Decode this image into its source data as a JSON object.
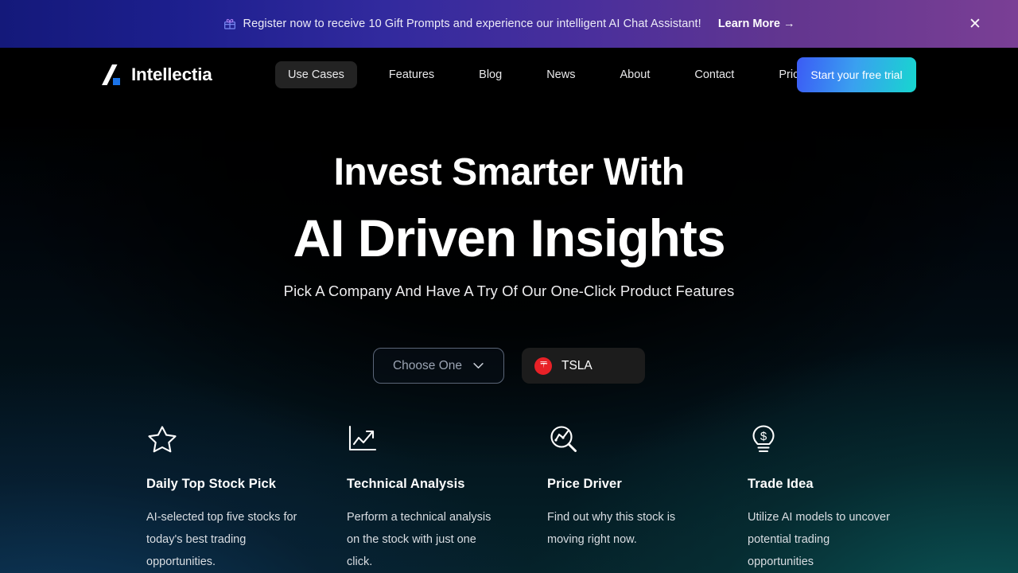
{
  "banner": {
    "icon": "gift-icon",
    "message": "Register now to receive 10 Gift Prompts and experience our intelligent AI Chat Assistant!",
    "learn_more": "Learn More →",
    "close": "✕",
    "gradient_from": "#14197a",
    "gradient_to": "#7a3f95"
  },
  "nav": {
    "logo_text": "Intellectia",
    "logo_accent": "#1a73e8",
    "items": [
      {
        "label": "Use Cases",
        "active": true
      },
      {
        "label": "Features",
        "active": false
      },
      {
        "label": "Blog",
        "active": false
      },
      {
        "label": "News",
        "active": false
      },
      {
        "label": "About",
        "active": false
      },
      {
        "label": "Contact",
        "active": false
      },
      {
        "label": "Pricing",
        "active": false
      }
    ],
    "cta_label": "Start your free trial",
    "cta_gradient_from": "#3b5bf5",
    "cta_gradient_to": "#17d6cf"
  },
  "hero": {
    "headline_line1": "Invest Smarter With",
    "headline_line2": "AI Driven Insights",
    "subheadline": "Pick A Company And Have A Try Of Our One-Click Product Features"
  },
  "selector": {
    "dropdown_label": "Choose One",
    "dropdown_icon": "chevron-down-icon",
    "ticker_symbol": "TSLA",
    "ticker_logo_color": "#e82127"
  },
  "features": [
    {
      "icon": "star-outline-icon",
      "title": "Daily Top Stock Pick",
      "description": "AI-selected top five stocks for today's best trading opportunities."
    },
    {
      "icon": "trending-up-chart-icon",
      "title": "Technical Analysis",
      "description": "Perform a technical analysis on the stock with just one click."
    },
    {
      "icon": "magnifier-chart-icon",
      "title": "Price Driver",
      "description": "Find out why this stock is moving right now."
    },
    {
      "icon": "lightbulb-dollar-icon",
      "title": "Trade Idea",
      "description": "Utilize AI models to uncover potential trading opportunities"
    }
  ]
}
